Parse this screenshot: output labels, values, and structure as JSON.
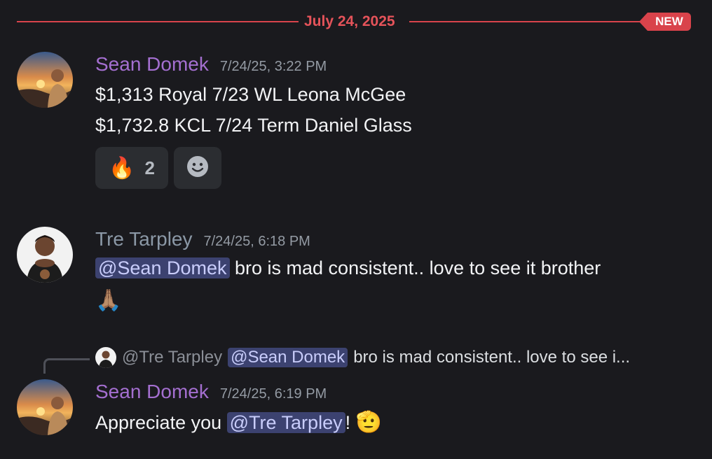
{
  "divider": {
    "date": "July 24, 2025",
    "badge": "NEW"
  },
  "messages": [
    {
      "author": "Sean Domek",
      "timestamp": "7/24/25, 3:22 PM",
      "lines": [
        "$1,313 Royal 7/23 WL Leona McGee",
        "$1,732.8 KCL 7/24 Term Daniel Glass"
      ],
      "reactions": [
        {
          "emoji": "🔥",
          "icon": "fire-icon",
          "count": "2"
        },
        {
          "icon": "add-reaction-icon"
        }
      ]
    },
    {
      "author": "Tre Tarpley",
      "timestamp": "7/24/25, 6:18 PM",
      "mention": "@Sean Domek",
      "text": " bro is mad consistent.. love to see it brother",
      "emoji": "🙏🏽"
    },
    {
      "reply": {
        "author": "@Tre Tarpley",
        "mention": "@Sean Domek",
        "text": "bro is mad consistent.. love to see i..."
      },
      "author": "Sean Domek",
      "timestamp": "7/24/25, 6:19 PM",
      "text_before": "Appreciate you ",
      "mention": "@Tre Tarpley",
      "text_after": "!",
      "emoji": "🫡"
    }
  ],
  "colors": {
    "background": "#1a1a1e",
    "accent_red": "#d9434b",
    "username_purple": "#a46fd0",
    "username_gray": "#8b98a6",
    "mention_bg": "#3c4270"
  }
}
